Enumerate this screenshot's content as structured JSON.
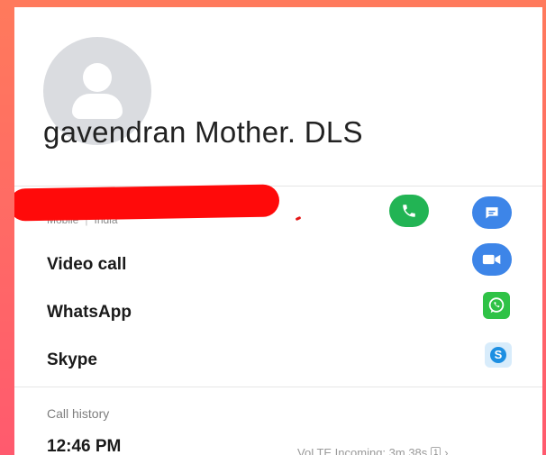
{
  "contact": {
    "name": "gavendran Mother. DLS",
    "phone_type": "Mobile",
    "phone_location": "India"
  },
  "actions": {
    "call_icon": "phone-icon",
    "message_icon": "message-icon",
    "video_icon": "video-camera-icon"
  },
  "rows": {
    "video_call": "Video call",
    "whatsapp": "WhatsApp",
    "skype": "Skype",
    "skype_badge": "S"
  },
  "call_history": {
    "title": "Call history",
    "entries": [
      {
        "time": "12:46 PM",
        "detail": "VoLTE  Incoming: 3m 38s",
        "sim": "1"
      }
    ]
  },
  "colors": {
    "call_green": "#22b454",
    "action_blue": "#3d85e8",
    "whatsapp_green": "#2fc246",
    "redaction_red": "#ff0a0a"
  }
}
